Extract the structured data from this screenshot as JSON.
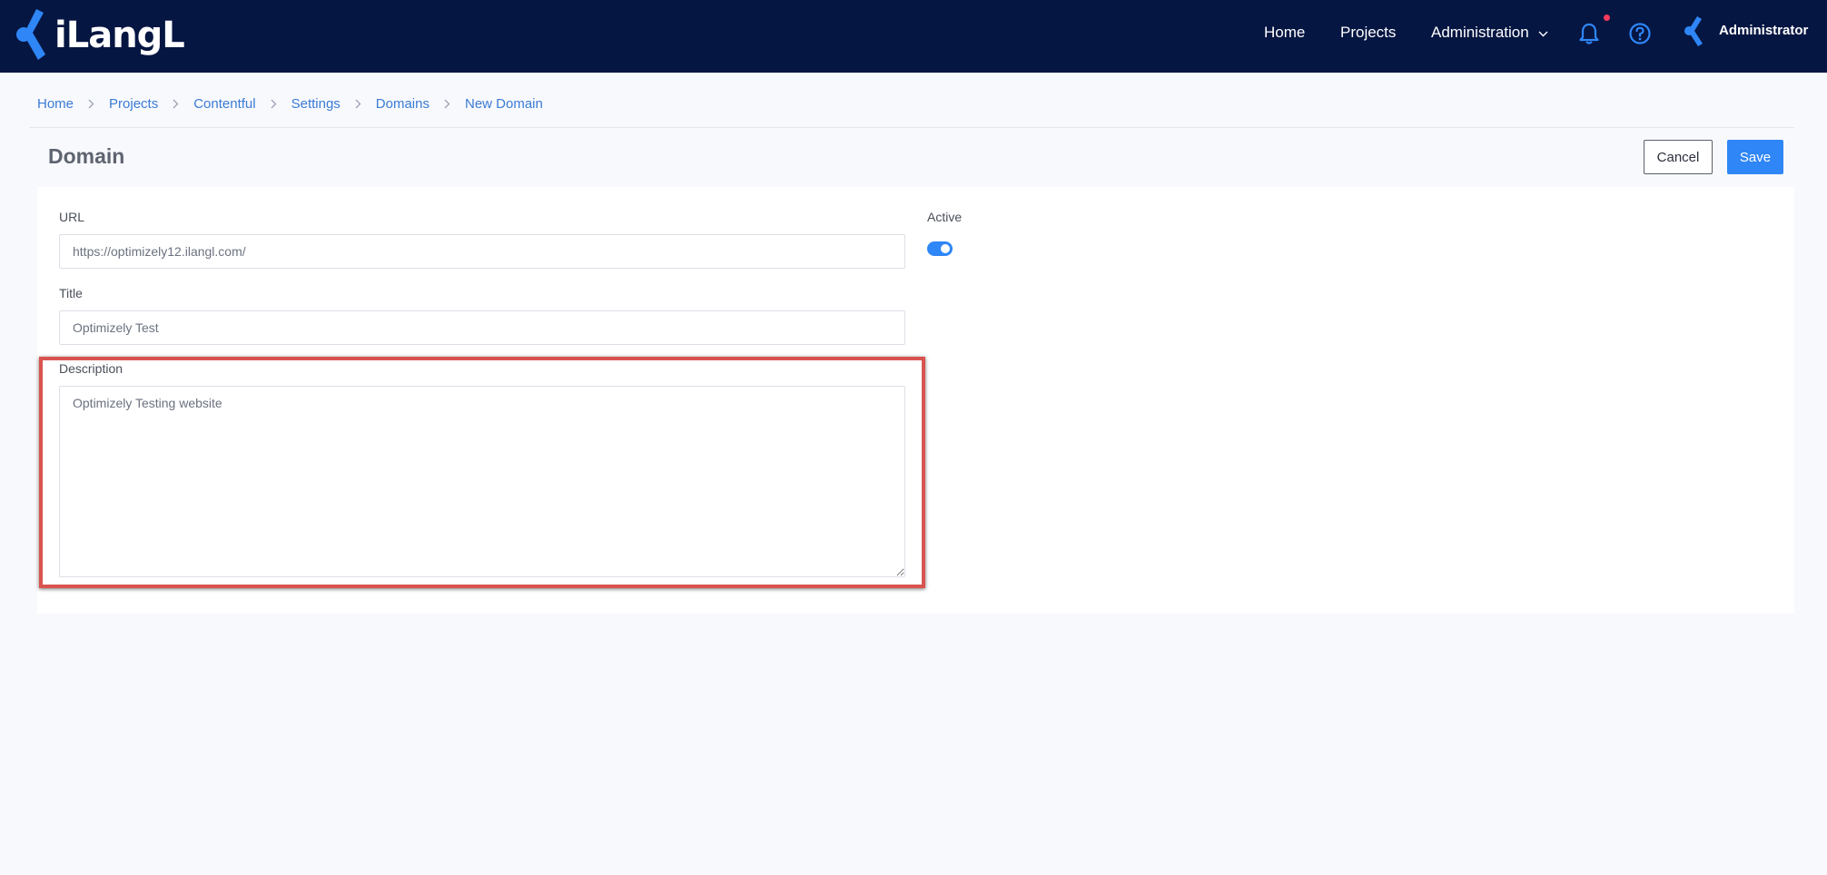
{
  "app": {
    "logo_text": "iLangL",
    "brand_color": "#2f86f6",
    "nav_bg": "#061642"
  },
  "nav": {
    "home": "Home",
    "projects": "Projects",
    "administration": "Administration",
    "user_name": "Administrator",
    "notifications_icon": "bell-icon",
    "help_icon": "help-circle-icon"
  },
  "breadcrumb": {
    "items": [
      "Home",
      "Projects",
      "Contentful",
      "Settings",
      "Domains",
      "New Domain"
    ]
  },
  "page": {
    "title": "Domain",
    "cancel_label": "Cancel",
    "save_label": "Save"
  },
  "form": {
    "url_label": "URL",
    "url_value": "https://optimizely12.ilangl.com/",
    "title_label": "Title",
    "title_value": "Optimizely Test",
    "description_label": "Description",
    "description_value": "Optimizely Testing website",
    "active_label": "Active",
    "active": true
  }
}
